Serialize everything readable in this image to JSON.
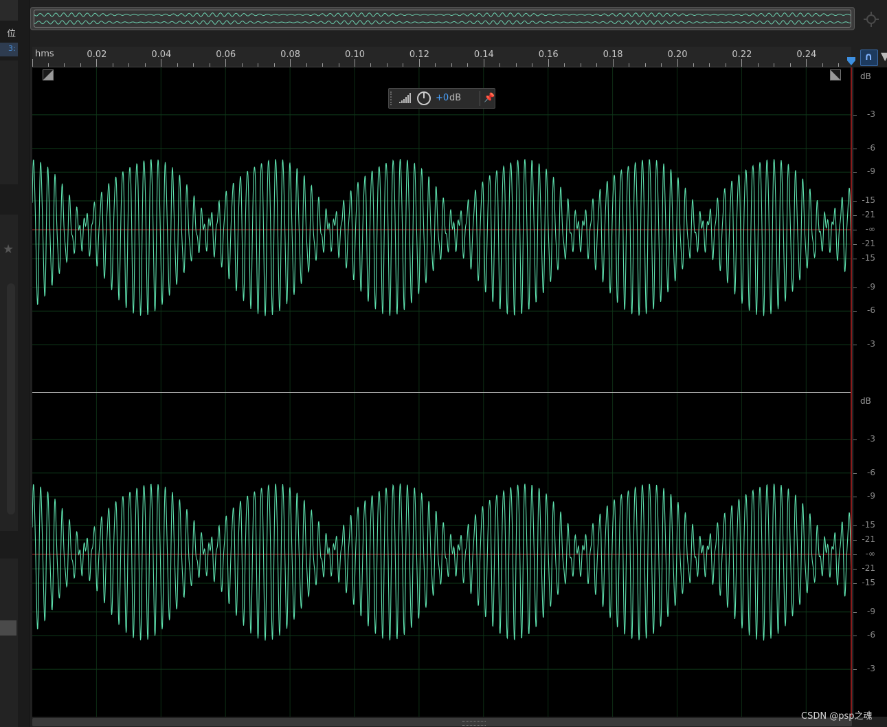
{
  "sidebar": {
    "label_1": "位",
    "label_2": "3:",
    "star_icon": "star-icon"
  },
  "ruler": {
    "unit_label": "hms",
    "ticks": [
      "0.02",
      "0.04",
      "0.06",
      "0.08",
      "0.10",
      "0.12",
      "0.14",
      "0.16",
      "0.18",
      "0.20",
      "0.22",
      "0.24"
    ]
  },
  "gain_hud": {
    "value": "+0",
    "unit": "dB"
  },
  "db_scale": {
    "channel_1": {
      "unit": "dB",
      "labels": [
        "-3",
        "-6",
        "-9",
        "-15",
        "-21",
        "-∞",
        "-21",
        "-15",
        "-9",
        "-6",
        "-3"
      ]
    },
    "channel_2": {
      "unit": "dB",
      "labels": [
        "-3",
        "-6",
        "-9",
        "-15",
        "-21",
        "-∞",
        "-21",
        "-15",
        "-9",
        "-6",
        "-3"
      ]
    }
  },
  "watermark": "CSDN @psp之魂",
  "colors": {
    "waveform": "#5fe3b0",
    "grid": "#0f3a1a",
    "zero_line": "#b02a2a",
    "accent": "#4aa3ff"
  },
  "icons": [
    "star-icon",
    "zoom-navigator-icon",
    "playhead-marker-icon",
    "snap-icon",
    "filter-icon",
    "meter-icon",
    "knob-icon",
    "pin-icon",
    "corner-fade-in-icon",
    "corner-fade-out-icon"
  ]
}
